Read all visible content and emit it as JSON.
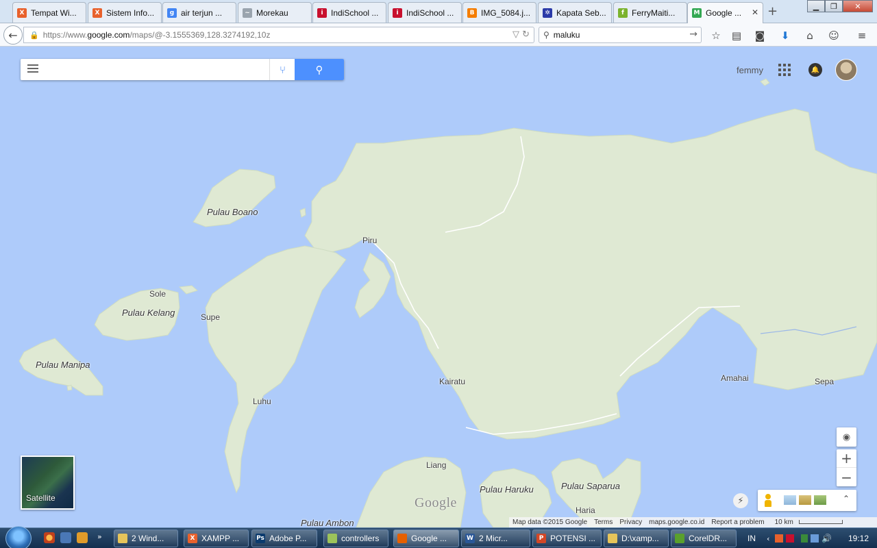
{
  "browser": {
    "tabs": [
      {
        "title": "Tempat Wi...",
        "icon": "xampp-icon",
        "color": "#e8612c",
        "glyph": "X"
      },
      {
        "title": "Sistem Info...",
        "icon": "xampp-icon",
        "color": "#e8612c",
        "glyph": "X"
      },
      {
        "title": "air terjun ...",
        "icon": "google-icon",
        "color": "#4285f4",
        "glyph": "g"
      },
      {
        "title": "Morekau",
        "icon": "page-icon",
        "color": "#9aa4ae",
        "glyph": "~"
      },
      {
        "title": "IndiSchool ...",
        "icon": "indischool-icon",
        "color": "#c8102e",
        "glyph": "i"
      },
      {
        "title": "IndiSchool ...",
        "icon": "indischool-icon",
        "color": "#c8102e",
        "glyph": "i"
      },
      {
        "title": "IMG_5084.j...",
        "icon": "blogger-icon",
        "color": "#f57d00",
        "glyph": "B"
      },
      {
        "title": "Kapata Seb...",
        "icon": "gear-icon",
        "color": "#2b3aa8",
        "glyph": "✲"
      },
      {
        "title": "FerryMaiti...",
        "icon": "leaf-icon",
        "color": "#7bb32e",
        "glyph": "f"
      },
      {
        "title": "Google ...",
        "icon": "google-maps-icon",
        "color": "#34a853",
        "glyph": "M",
        "active": true
      }
    ],
    "url_prefix": "https://www.",
    "url_domain": "google.com",
    "url_path": "/maps/@-3.1555369,128.3274192,10z",
    "search_value": "maluku"
  },
  "maps": {
    "search_placeholder": "",
    "username": "femmy",
    "satellite_label": "Satellite",
    "logo_text": "Google",
    "footer": {
      "map_data": "Map data ©2015 Google",
      "terms": "Terms",
      "privacy": "Privacy",
      "domain": "maps.google.co.id",
      "report": "Report a problem",
      "scale": "10 km"
    },
    "places": [
      {
        "name": "Pulau Boano",
        "kind": "island"
      },
      {
        "name": "Piru",
        "kind": "town"
      },
      {
        "name": "Sole",
        "kind": "town"
      },
      {
        "name": "Pulau Kelang",
        "kind": "island"
      },
      {
        "name": "Supe",
        "kind": "town"
      },
      {
        "name": "Pulau Manipa",
        "kind": "island"
      },
      {
        "name": "Kairatu",
        "kind": "town"
      },
      {
        "name": "Luhu",
        "kind": "town"
      },
      {
        "name": "Amahai",
        "kind": "town"
      },
      {
        "name": "Sepa",
        "kind": "town"
      },
      {
        "name": "Liang",
        "kind": "town"
      },
      {
        "name": "Pulau Haruku",
        "kind": "island"
      },
      {
        "name": "Pulau Saparua",
        "kind": "island"
      },
      {
        "name": "Haria",
        "kind": "town"
      },
      {
        "name": "Pulau Ambon",
        "kind": "island"
      }
    ]
  },
  "taskbar": {
    "buttons": [
      {
        "label": "2 Wind...",
        "icon": "folder-icon",
        "color": "#e6c45a",
        "glyph": ""
      },
      {
        "label": "XAMPP ...",
        "icon": "xampp-icon",
        "color": "#e8612c",
        "glyph": "X"
      },
      {
        "label": "Adobe P...",
        "icon": "photoshop-icon",
        "color": "#0b3a6d",
        "glyph": "Ps"
      },
      {
        "label": "controllers",
        "icon": "folder-icon",
        "color": "#9cc35a",
        "glyph": ""
      },
      {
        "label": "Google ...",
        "icon": "firefox-icon",
        "color": "#e66000",
        "glyph": "",
        "active": true
      },
      {
        "label": "2 Micr...",
        "icon": "word-icon",
        "color": "#2b5797",
        "glyph": "W"
      },
      {
        "label": "POTENSI ...",
        "icon": "powerpoint-icon",
        "color": "#d24726",
        "glyph": "P"
      },
      {
        "label": "D:\\xamp...",
        "icon": "folder-icon",
        "color": "#e6c45a",
        "glyph": ""
      },
      {
        "label": "CorelDR...",
        "icon": "coreldraw-icon",
        "color": "#5aa02c",
        "glyph": ""
      }
    ],
    "input_lang": "IN",
    "clock": "19:12"
  },
  "colors": {
    "water": "#aecbfa",
    "land": "#dfe9d3",
    "accent": "#4d90fe"
  }
}
